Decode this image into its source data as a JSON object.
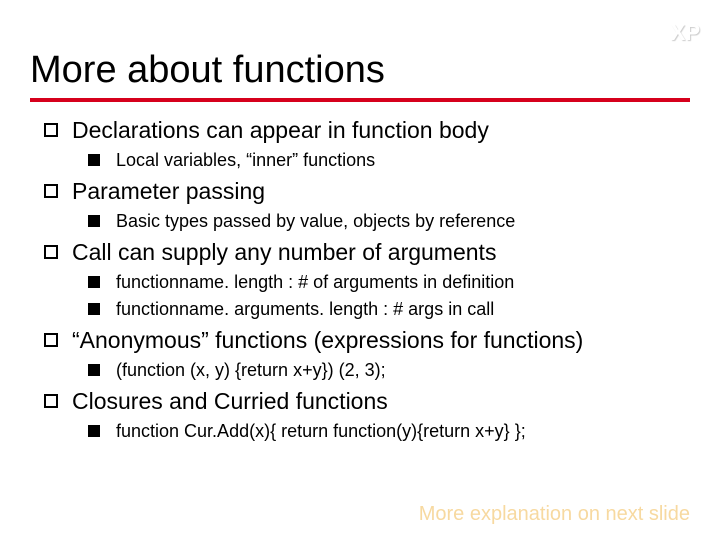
{
  "corner_label": "XP",
  "title": "More about functions",
  "items": [
    {
      "text": "Declarations can appear in function body",
      "sub": [
        "Local variables, “inner” functions"
      ]
    },
    {
      "text": "Parameter passing",
      "sub": [
        "Basic types passed by value, objects by reference"
      ]
    },
    {
      "text": "Call can supply any number of arguments",
      "sub": [
        "functionname. length : # of arguments in definition",
        "functionname. arguments. length : # args in call"
      ]
    },
    {
      "text": "“Anonymous” functions (expressions for functions)",
      "sub": [
        "(function (x, y) {return x+y}) (2, 3);"
      ]
    },
    {
      "text": "Closures and Curried functions",
      "sub": [
        "function Cur.Add(x){ return function(y){return x+y} };"
      ]
    }
  ],
  "footnote": "More explanation on next slide"
}
